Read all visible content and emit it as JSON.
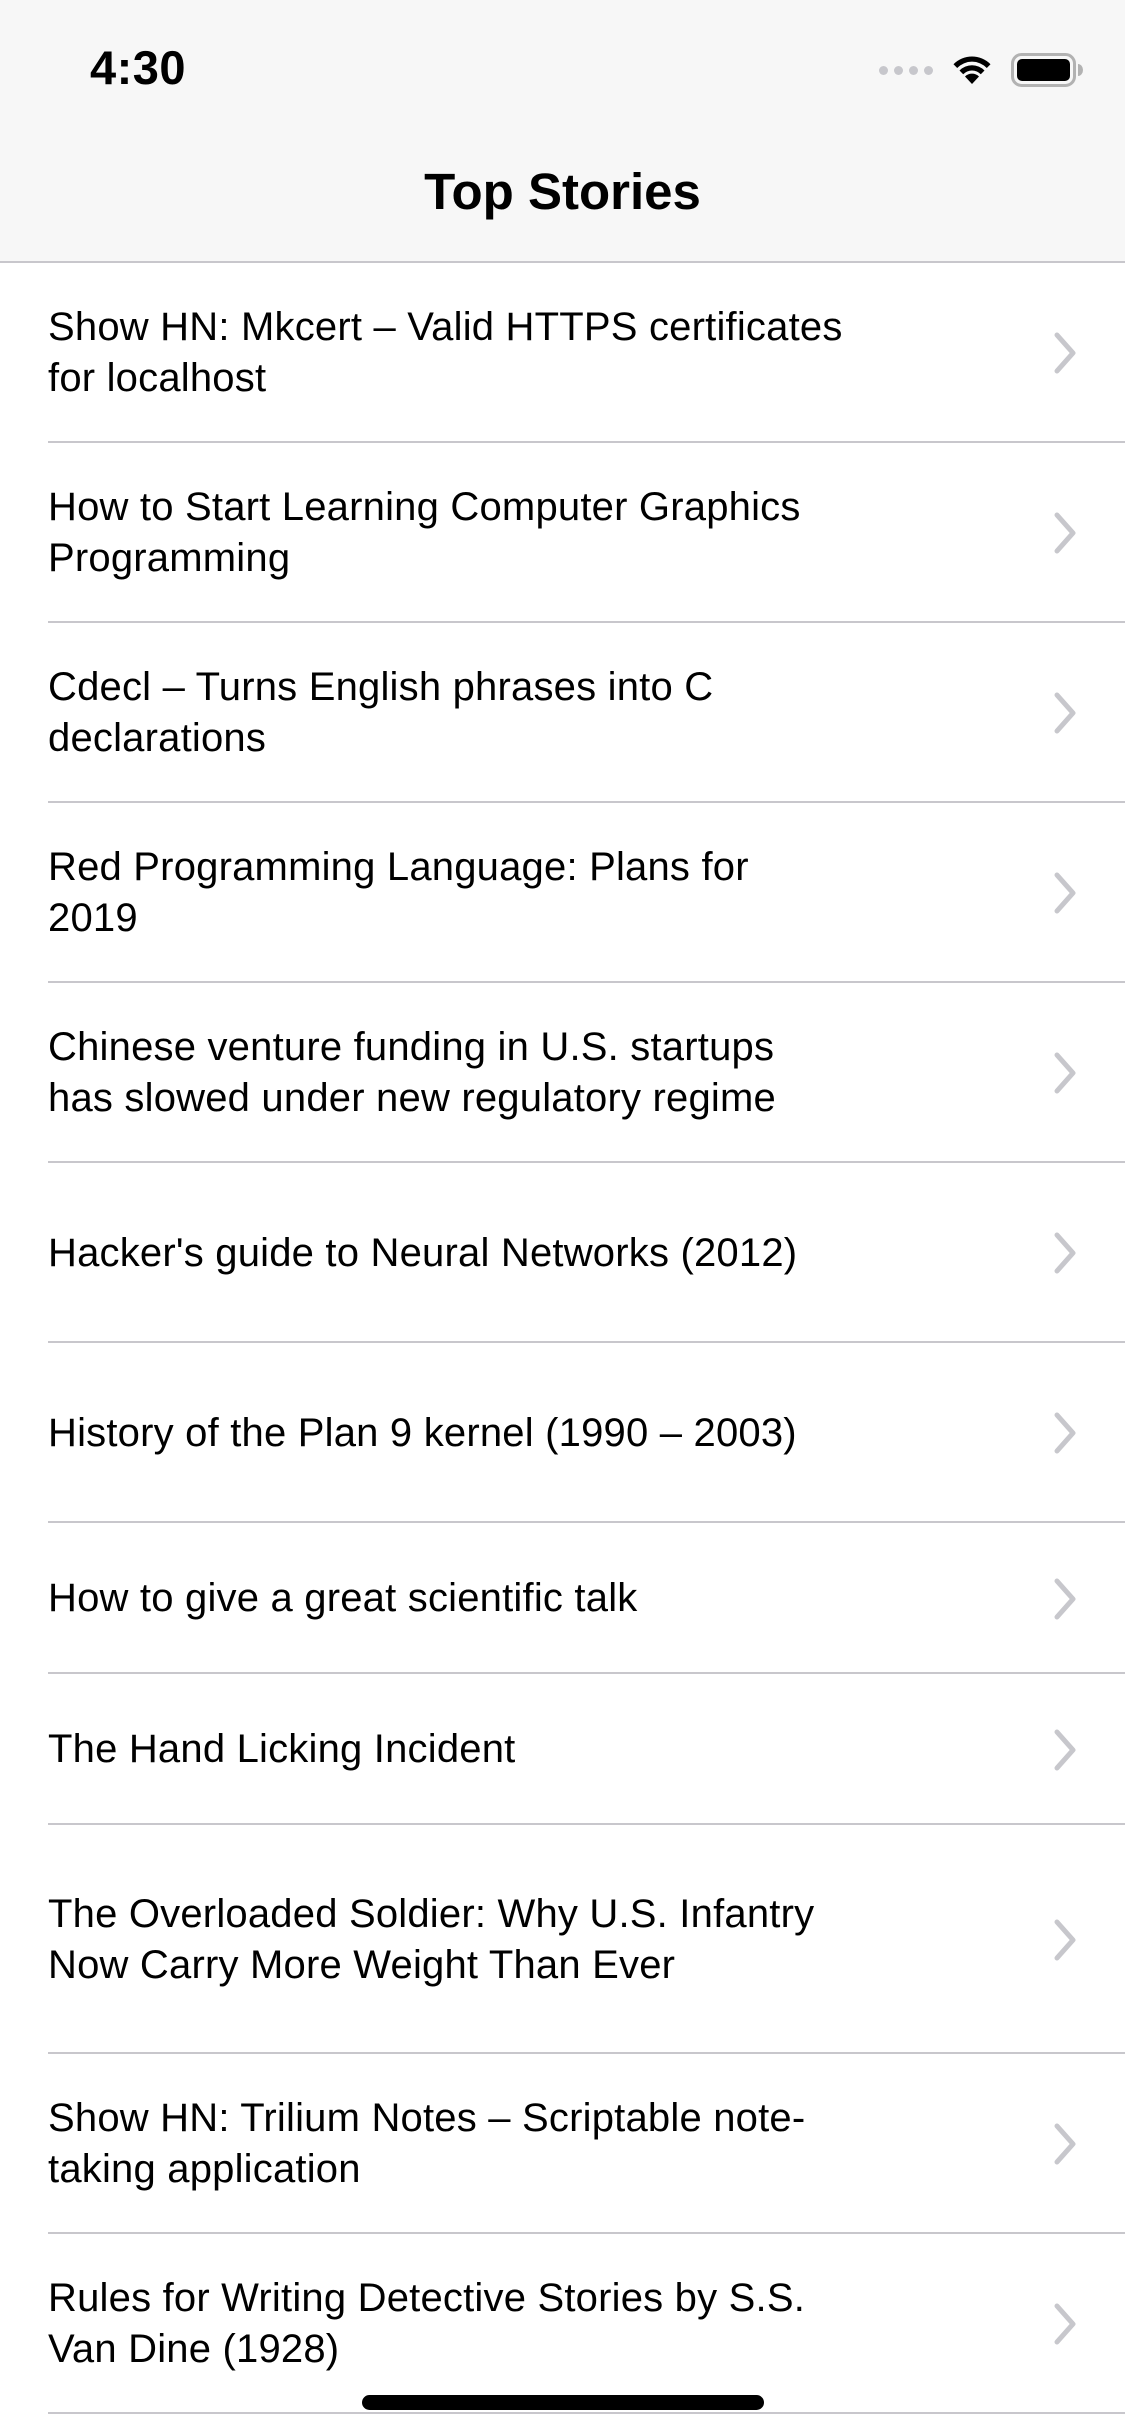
{
  "status_bar": {
    "time": "4:30",
    "icons": [
      "cellular-signal-icon",
      "wifi-icon",
      "battery-icon"
    ]
  },
  "nav": {
    "title": "Top Stories"
  },
  "stories": [
    {
      "title": "Show HN: Mkcert – Valid HTTPS certificates for localhost"
    },
    {
      "title": "How to Start Learning Computer Graphics Programming"
    },
    {
      "title": "Cdecl – Turns English phrases into C declarations"
    },
    {
      "title": "Red Programming Language: Plans for 2019"
    },
    {
      "title": "Chinese venture funding in U.S. startups has slowed under new regulatory regime"
    },
    {
      "title": "Hacker's guide to Neural Networks (2012)"
    },
    {
      "title": "History of the Plan 9 kernel (1990 – 2003)"
    },
    {
      "title": "How to give a great scientific talk"
    },
    {
      "title": "The Hand Licking Incident"
    },
    {
      "title": "The Overloaded Soldier: Why U.S. Infantry Now Carry More Weight Than Ever"
    },
    {
      "title": "Show HN: Trilium Notes – Scriptable note-taking application"
    },
    {
      "title": "Rules for Writing Detective Stories by S.S. Van Dine (1928)"
    }
  ],
  "colors": {
    "separator": "#c8c7cc",
    "chevron": "#c7c7cc",
    "nav_background": "#f7f7f7"
  }
}
